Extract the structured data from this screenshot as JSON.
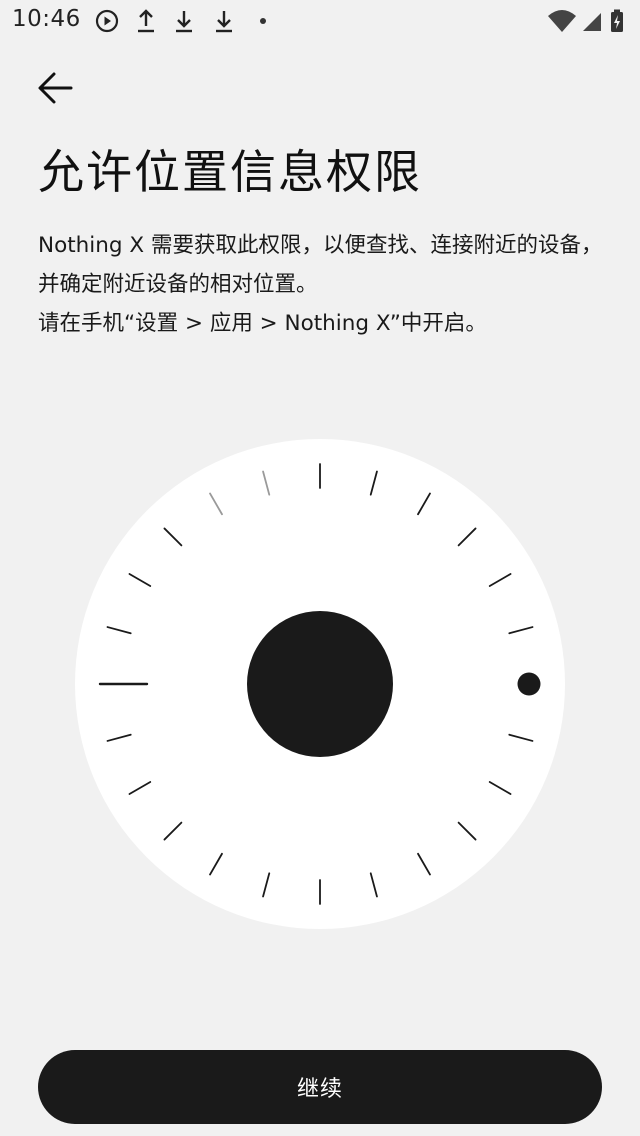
{
  "status_bar": {
    "time": "10:46",
    "left_icons": [
      "play-circle-icon",
      "upload-icon",
      "download-icon",
      "download-icon",
      "notification-dot-icon"
    ],
    "right_icons": [
      "wifi-icon",
      "cellular-signal-icon",
      "battery-charging-icon"
    ]
  },
  "header": {
    "back_icon": "arrow-left-icon"
  },
  "title": "允许位置信息权限",
  "description": {
    "line1": "Nothing X 需要获取此权限，以便查找、连接附近的设备，并确定附近设备的相对位置。",
    "line2": "请在手机“设置 > 应用 > Nothing X”中开启。"
  },
  "dial": {
    "background_color": "#ffffff",
    "center_color": "#1a1a1a"
  },
  "continue_button": {
    "label": "继续"
  },
  "colors": {
    "background": "#f1f1f1",
    "button": "#1a1a1a",
    "text": "#111111"
  }
}
